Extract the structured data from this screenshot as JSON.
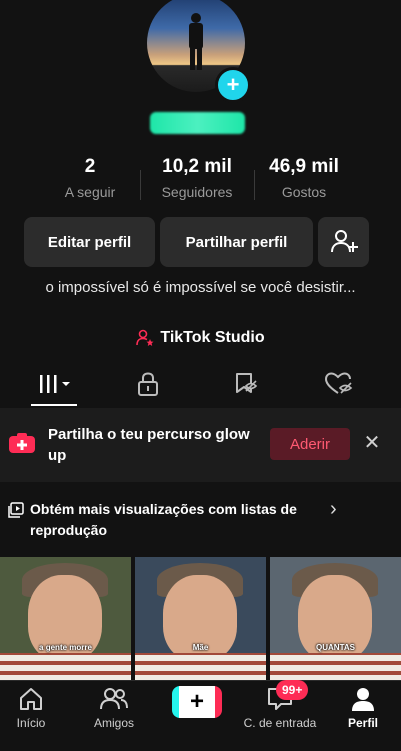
{
  "profile": {
    "avatar_add_icon": "plus-icon"
  },
  "stats": [
    {
      "value": "2",
      "label": "A seguir"
    },
    {
      "value": "10,2 mil",
      "label": "Seguidores"
    },
    {
      "value": "46,9 mil",
      "label": "Gostos"
    }
  ],
  "buttons": {
    "edit": "Editar perfil",
    "share": "Partilhar perfil",
    "add_friend_icon": "add-user-icon"
  },
  "bio": "o impossível só é impossível se você desistir...",
  "studio": "TikTok Studio",
  "banner": {
    "text": "Partilha o teu percurso glow up",
    "cta": "Aderir",
    "close": "✕"
  },
  "playlist": {
    "text": "Obtém mais visualizações com listas de reprodução",
    "chevron": "›"
  },
  "videos": [
    {
      "caption": "a gente morre"
    },
    {
      "caption": "Mãe"
    },
    {
      "caption": "QUANTAS"
    }
  ],
  "nav": {
    "home": "Início",
    "friends": "Amigos",
    "create": "+",
    "inbox": "C. de entrada",
    "inbox_badge": "99+",
    "profile": "Perfil"
  },
  "colors": {
    "accent": "#fe2c55",
    "teal": "#20d5ec",
    "background": "#121212"
  }
}
